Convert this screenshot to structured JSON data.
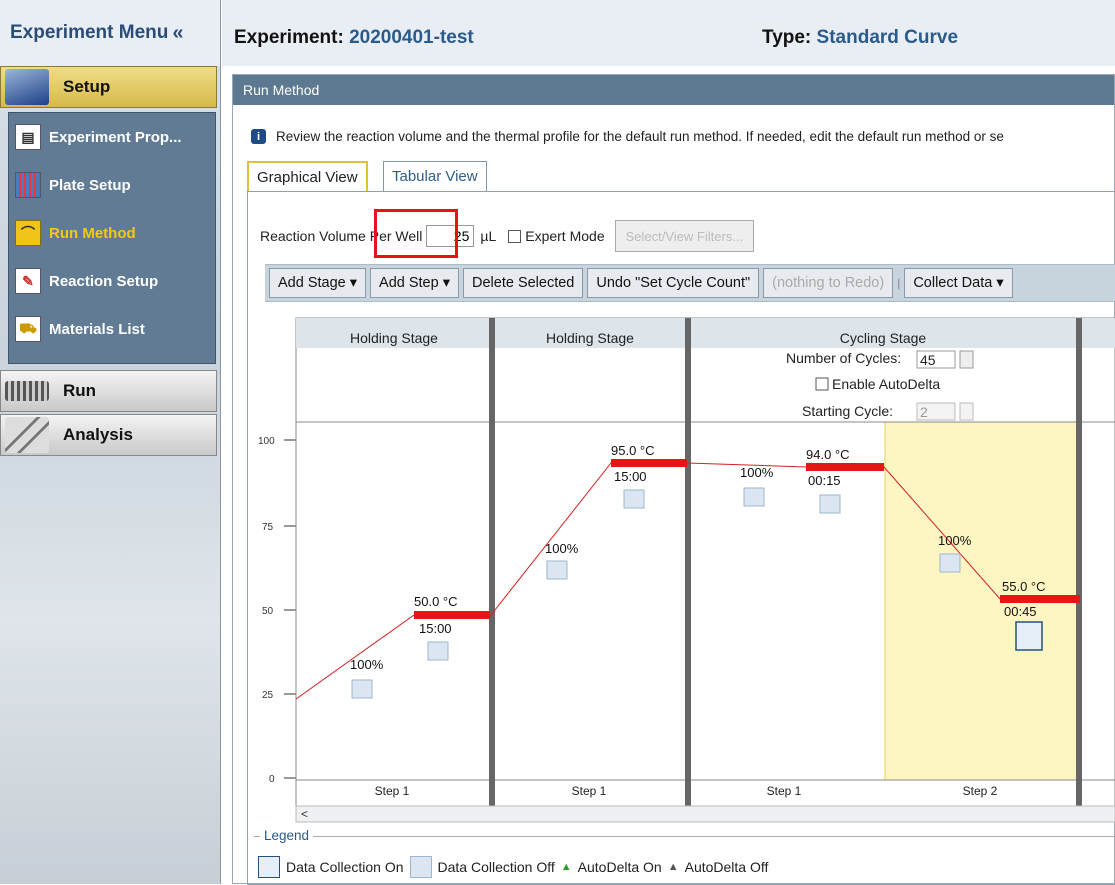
{
  "sidebar": {
    "title": "Experiment Menu",
    "collapse": "«",
    "setup": "Setup",
    "items": [
      {
        "label": "Experiment Prop...",
        "icon": "document-icon"
      },
      {
        "label": "Plate Setup",
        "icon": "plate-grid-icon"
      },
      {
        "label": "Run Method",
        "icon": "thermal-profile-icon",
        "active": true
      },
      {
        "label": "Reaction Setup",
        "icon": "pipette-icon"
      },
      {
        "label": "Materials List",
        "icon": "cart-icon"
      }
    ],
    "run": "Run",
    "analysis": "Analysis"
  },
  "header": {
    "experiment_label": "Experiment:",
    "experiment_name": "20200401-test",
    "type_label": "Type:",
    "type_value": "Standard Curve"
  },
  "panel": {
    "title": "Run Method",
    "info": "Review the reaction volume and the thermal profile for the default run method. If needed, edit the default run method or se",
    "tabs": [
      "Graphical View",
      "Tabular View"
    ],
    "volume_label": "Reaction Volume Per Well",
    "volume_value": "25",
    "volume_unit": "µL",
    "expert_mode": "Expert Mode",
    "filters_button": "Select/View Filters..."
  },
  "toolbar": {
    "add_stage": "Add Stage ▾",
    "add_step": "Add Step ▾",
    "delete": "Delete Selected",
    "undo": "Undo \"Set Cycle Count\"",
    "redo": "(nothing to Redo)",
    "collect": "Collect Data ▾"
  },
  "chart": {
    "y_ticks": [
      "100",
      "75",
      "50",
      "25",
      "0"
    ],
    "stages": [
      "Holding Stage",
      "Holding Stage",
      "Cycling Stage"
    ],
    "cycles_label": "Number of Cycles:",
    "cycles_value": "45",
    "autodelta_label": "Enable AutoDelta",
    "starting_cycle_label": "Starting Cycle:",
    "starting_cycle_value": "2",
    "scroll_arrow": "<",
    "steps": [
      {
        "label": "Step 1",
        "temp": "50.0 °C",
        "time": "15:00",
        "ramp": "100%",
        "value": 50.0
      },
      {
        "label": "Step 1",
        "temp": "95.0 °C",
        "time": "15:00",
        "ramp": "100%",
        "value": 95.0
      },
      {
        "label": "Step 1",
        "temp": "94.0 °C",
        "time": "00:15",
        "ramp": "100%",
        "value": 94.0
      },
      {
        "label": "Step 2",
        "temp": "55.0 °C",
        "time": "00:45",
        "ramp": "100%",
        "value": 55.0
      }
    ]
  },
  "legend": {
    "title": "Legend",
    "on": "Data Collection On",
    "off": "Data Collection Off",
    "ad_on": "AutoDelta On",
    "ad_off": "AutoDelta Off"
  }
}
